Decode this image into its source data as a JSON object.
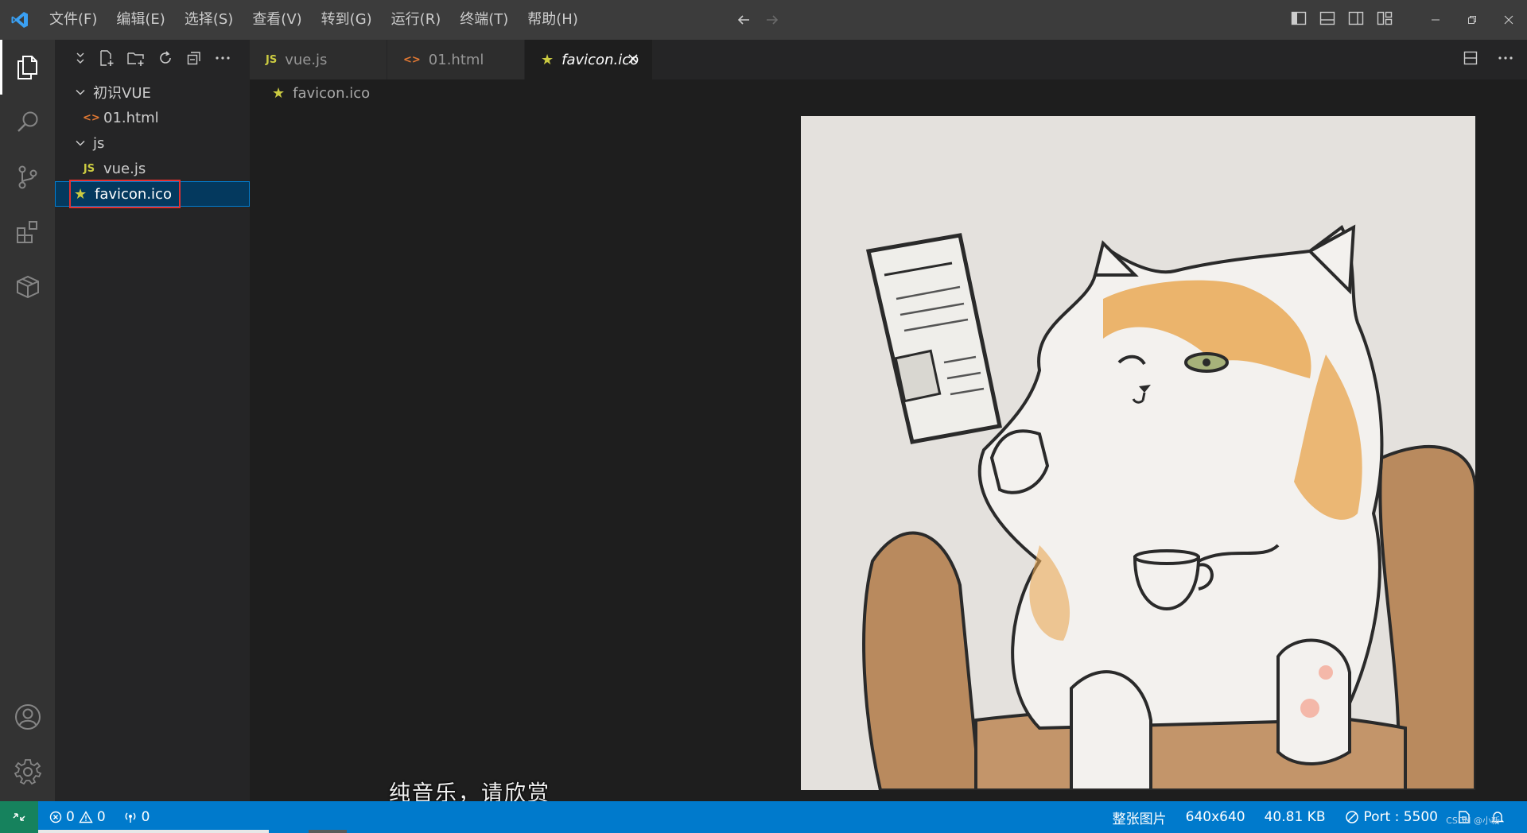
{
  "titlebar": {
    "menus": [
      "文件(F)",
      "编辑(E)",
      "选择(S)",
      "查看(V)",
      "转到(G)",
      "运行(R)",
      "终端(T)",
      "帮助(H)"
    ]
  },
  "activitybar": {
    "items": [
      "explorer-icon",
      "search-icon",
      "source-control-icon",
      "extensions-icon",
      "remote-explorer-icon"
    ],
    "bottom": [
      "accounts-icon",
      "manage-gear-icon"
    ]
  },
  "explorer": {
    "root_folder": "初识VUE",
    "items": [
      {
        "label": "01.html",
        "type": "html",
        "icon_text": "<>"
      },
      {
        "label": "js",
        "type": "folder"
      },
      {
        "label": "vue.js",
        "type": "js",
        "icon_text": "JS"
      },
      {
        "label": "favicon.ico",
        "type": "ico",
        "icon_text": "★",
        "selected": true
      }
    ]
  },
  "tabs": [
    {
      "label": "vue.js",
      "icon_text": "JS"
    },
    {
      "label": "01.html",
      "icon_text": "<>"
    },
    {
      "label": "favicon.ico",
      "icon_text": "★",
      "active": true
    }
  ],
  "breadcrumb": {
    "label": "favicon.ico",
    "icon_text": "★"
  },
  "overlay": {
    "subtitle": "纯音乐，请欣赏"
  },
  "statusbar": {
    "errors": "0",
    "warnings": "0",
    "ports": "0",
    "image_scope": "整张图片",
    "dimensions": "640x640",
    "size": "40.81 KB",
    "live_server": "Port : 5500",
    "watermark": "CSDN @小新"
  },
  "colors": {
    "accent": "#007acc",
    "remote": "#16825d",
    "selection_outline": "#e5302e",
    "js_yellow": "#cbcb41",
    "html_orange": "#e37933"
  }
}
